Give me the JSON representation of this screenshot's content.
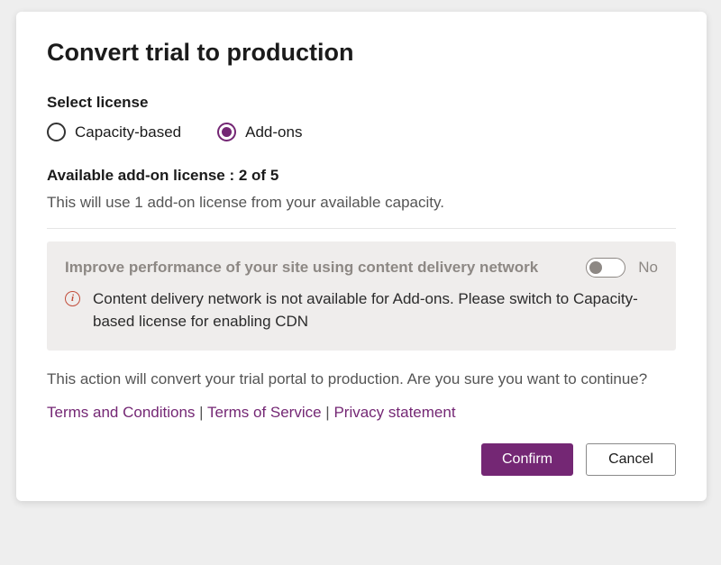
{
  "title": "Convert trial to production",
  "license": {
    "section_label": "Select license",
    "options": [
      {
        "label": "Capacity-based",
        "selected": false
      },
      {
        "label": "Add-ons",
        "selected": true
      }
    ]
  },
  "available_line": "Available add-on license : 2 of 5",
  "usage_line": "This will use 1 add-on license from your available capacity.",
  "cdn": {
    "heading": "Improve performance of your site using content delivery network",
    "toggle_state": "No",
    "info_glyph": "i",
    "message": "Content delivery network is not available for Add-ons. Please switch to Capacity-based license for enabling CDN"
  },
  "confirm_text": "This action will convert your trial portal to production. Are you sure you want to continue?",
  "links": {
    "terms_conditions": "Terms and Conditions",
    "terms_service": "Terms of Service",
    "privacy": "Privacy statement",
    "sep": " | "
  },
  "buttons": {
    "confirm": "Confirm",
    "cancel": "Cancel"
  }
}
